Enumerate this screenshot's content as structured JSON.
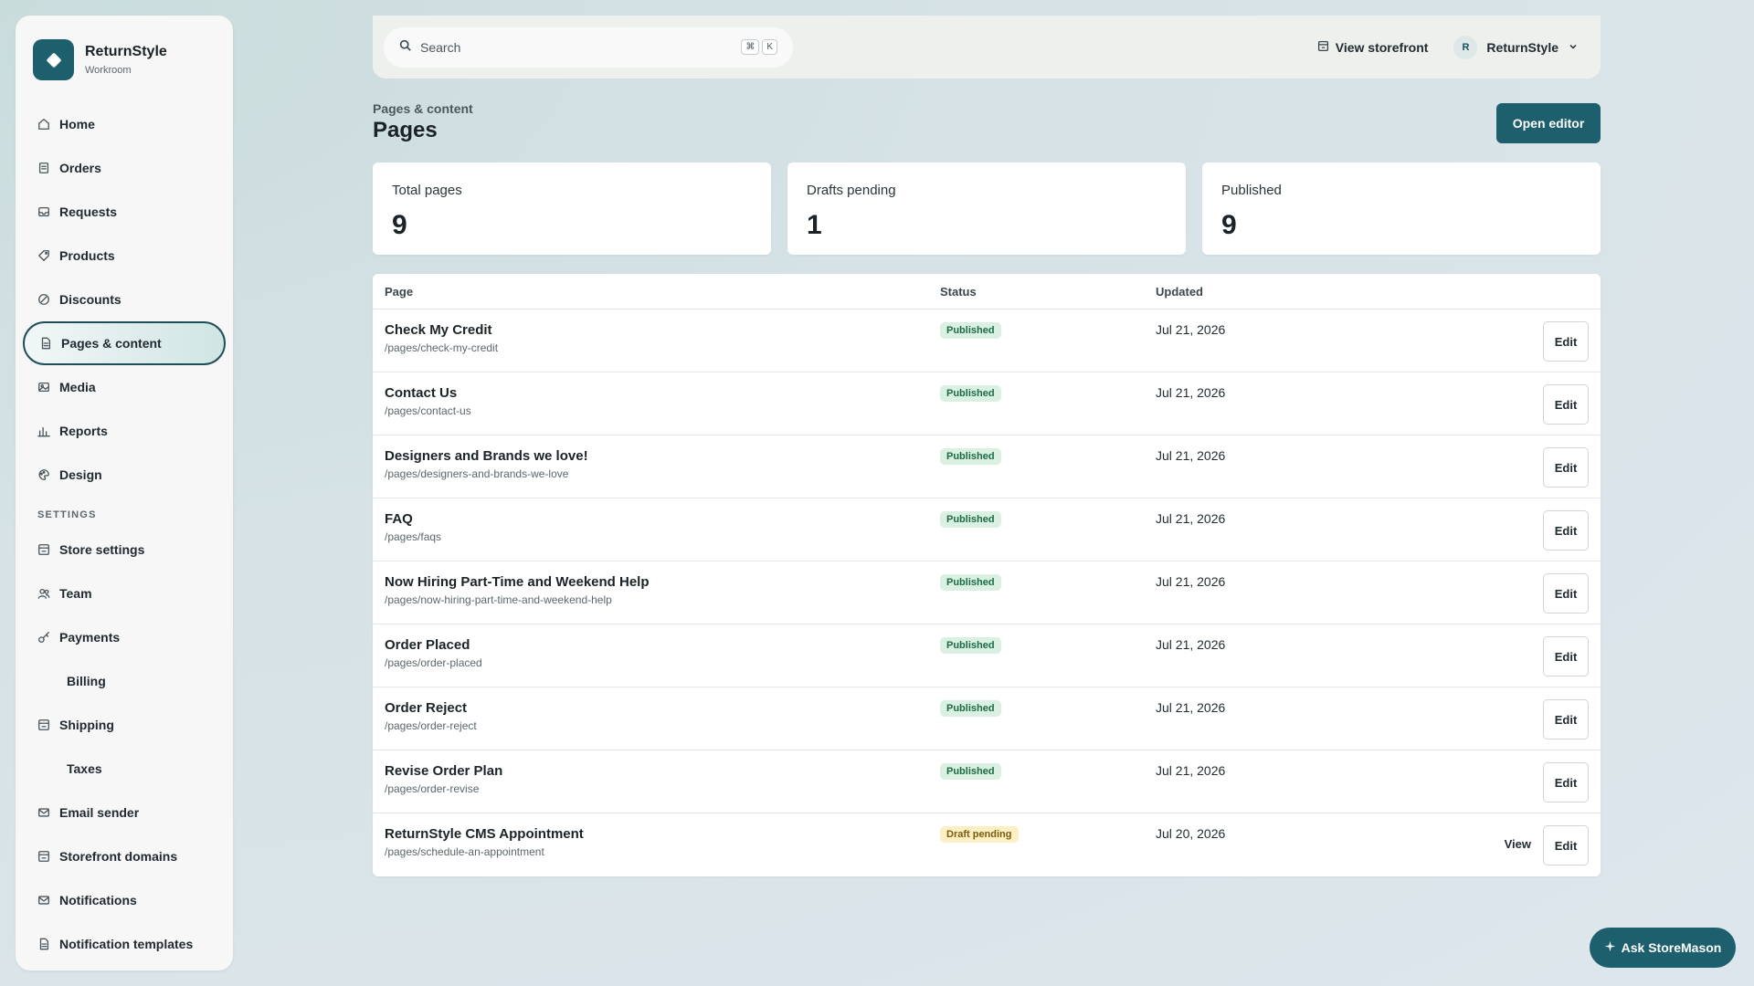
{
  "brand": {
    "name": "ReturnStyle",
    "subtitle": "Workroom"
  },
  "sidebar": {
    "items": [
      {
        "label": "Home",
        "icon": "home-icon"
      },
      {
        "label": "Orders",
        "icon": "receipt-icon"
      },
      {
        "label": "Requests",
        "icon": "inbox-icon"
      },
      {
        "label": "Products",
        "icon": "tag-icon"
      },
      {
        "label": "Discounts",
        "icon": "percent-icon"
      },
      {
        "label": "Pages & content",
        "icon": "document-icon",
        "active": true
      },
      {
        "label": "Media",
        "icon": "image-icon"
      },
      {
        "label": "Reports",
        "icon": "bar-chart-icon"
      },
      {
        "label": "Design",
        "icon": "palette-icon"
      }
    ],
    "settings_label": "SETTINGS",
    "settings_items": [
      {
        "label": "Store settings",
        "icon": "store-icon"
      },
      {
        "label": "Team",
        "icon": "users-icon"
      },
      {
        "label": "Payments",
        "icon": "key-icon"
      },
      {
        "label": "Billing",
        "icon": ""
      },
      {
        "label": "Shipping",
        "icon": "store-icon"
      },
      {
        "label": "Taxes",
        "icon": ""
      },
      {
        "label": "Email sender",
        "icon": "mail-icon"
      },
      {
        "label": "Storefront domains",
        "icon": "store-icon"
      },
      {
        "label": "Notifications",
        "icon": "mail-icon"
      },
      {
        "label": "Notification templates",
        "icon": "document-icon"
      }
    ]
  },
  "topbar": {
    "search_placeholder": "Search",
    "shortcut_keys": [
      "⌘",
      "K"
    ],
    "view_storefront": "View storefront",
    "account_initial": "R",
    "account_name": "ReturnStyle"
  },
  "header": {
    "breadcrumb": "Pages & content",
    "title": "Pages",
    "open_editor": "Open editor"
  },
  "stats": [
    {
      "label": "Total pages",
      "value": "9"
    },
    {
      "label": "Drafts pending",
      "value": "1"
    },
    {
      "label": "Published",
      "value": "9"
    }
  ],
  "table": {
    "columns": [
      "Page",
      "Status",
      "Updated"
    ],
    "edit_label": "Edit",
    "view_label": "View",
    "rows": [
      {
        "title": "Check My Credit",
        "slug": "/pages/check-my-credit",
        "status": "Published",
        "updated": "Jul 21, 2026"
      },
      {
        "title": "Contact Us",
        "slug": "/pages/contact-us",
        "status": "Published",
        "updated": "Jul 21, 2026"
      },
      {
        "title": "Designers and Brands we love!",
        "slug": "/pages/designers-and-brands-we-love",
        "status": "Published",
        "updated": "Jul 21, 2026"
      },
      {
        "title": "FAQ",
        "slug": "/pages/faqs",
        "status": "Published",
        "updated": "Jul 21, 2026"
      },
      {
        "title": "Now Hiring Part-Time and Weekend Help",
        "slug": "/pages/now-hiring-part-time-and-weekend-help",
        "status": "Published",
        "updated": "Jul 21, 2026"
      },
      {
        "title": "Order Placed",
        "slug": "/pages/order-placed",
        "status": "Published",
        "updated": "Jul 21, 2026"
      },
      {
        "title": "Order Reject",
        "slug": "/pages/order-reject",
        "status": "Published",
        "updated": "Jul 21, 2026"
      },
      {
        "title": "Revise Order Plan",
        "slug": "/pages/order-revise",
        "status": "Published",
        "updated": "Jul 21, 2026"
      },
      {
        "title": "ReturnStyle CMS Appointment",
        "slug": "/pages/schedule-an-appointment",
        "status": "Draft pending",
        "updated": "Jul 20, 2026",
        "has_view": true
      }
    ]
  },
  "assistant": {
    "label": "Ask StoreMason"
  },
  "colors": {
    "accent": "#1d5f6c",
    "published_bg": "#d9f0e3",
    "draft_bg": "#fcefc4"
  }
}
